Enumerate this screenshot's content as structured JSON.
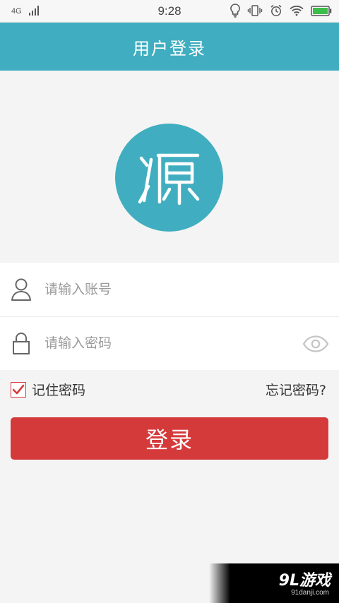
{
  "status_bar": {
    "network": "4G",
    "time": "9:28"
  },
  "header": {
    "title": "用户登录"
  },
  "logo": {
    "icon": "app-logo"
  },
  "form": {
    "account_placeholder": "请输入账号",
    "password_placeholder": "请输入密码"
  },
  "options": {
    "remember_label": "记住密码",
    "remember_checked": true,
    "forgot_label": "忘记密码?"
  },
  "login_button": {
    "label": "登录"
  },
  "watermark": {
    "main": "9L游戏",
    "sub": "91danji.com"
  },
  "colors": {
    "header": "#40aec0",
    "button": "#d53a3b",
    "checkbox": "#d9383a"
  }
}
